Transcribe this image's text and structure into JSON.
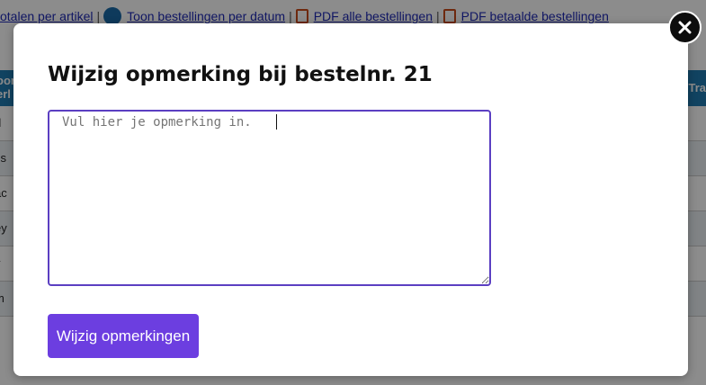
{
  "background": {
    "links": [
      {
        "label": "otalen per artikel",
        "icon": "none"
      },
      {
        "label": "Toon bestellingen per datum",
        "icon": "document-icon"
      },
      {
        "label": "PDF alle bestellingen",
        "icon": "pdf-icon"
      },
      {
        "label": "PDF betaalde bestellingen",
        "icon": "pdf-icon"
      }
    ],
    "separator": "|",
    "table_header": {
      "left": "oor\nerl",
      "right": "Tra"
    },
    "rows": [
      "rl",
      "ss",
      "ac",
      "ey",
      "y",
      "m"
    ]
  },
  "modal": {
    "title": "Wijzig opmerking bij bestelnr. 21",
    "remark_placeholder": "Vul hier je opmerking in.",
    "remark_value": "",
    "submit_label": "Wijzig opmerkingen",
    "close_icon": "close-icon"
  },
  "colors": {
    "accent": "#6c3ee0",
    "textarea_border": "#5b3fc2",
    "header_blue": "#1f7bb1",
    "close_bg": "#0d0d0d"
  }
}
